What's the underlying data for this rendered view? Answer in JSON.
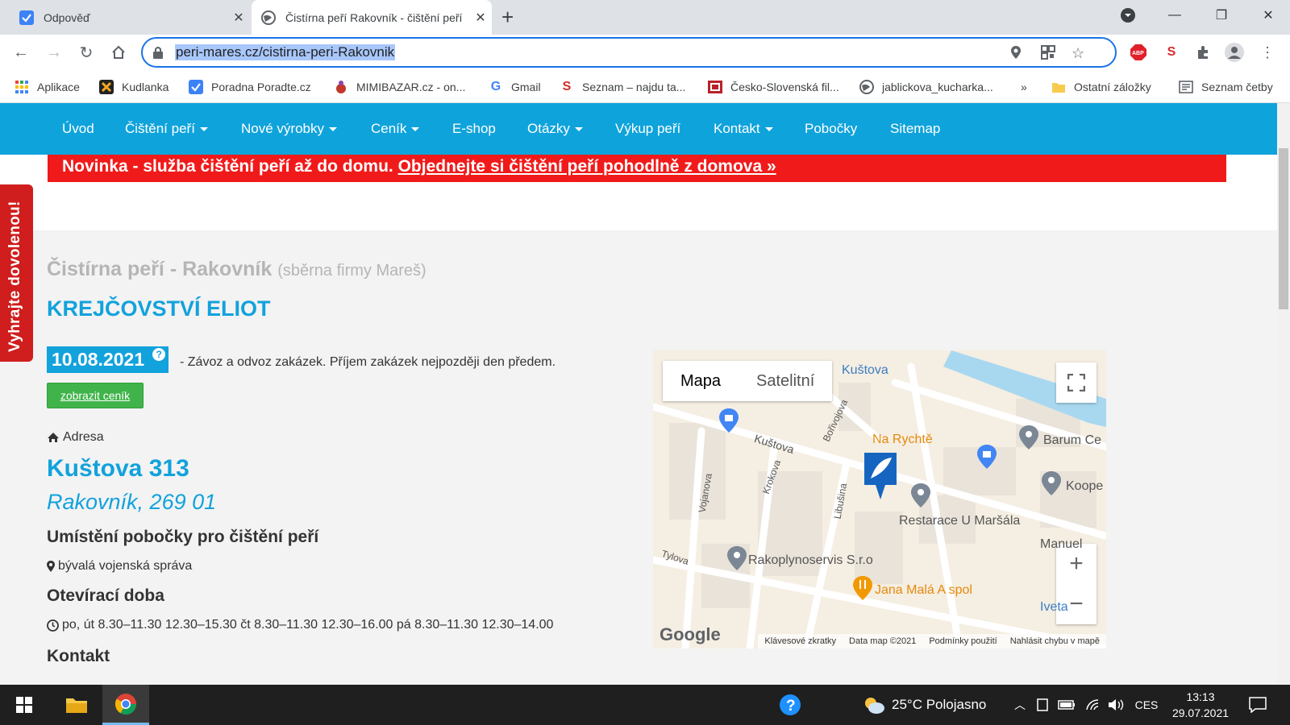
{
  "browser": {
    "tabs": [
      {
        "title": "Odpověď"
      },
      {
        "title": "Čistírna peří Rakovník - čištění peří"
      }
    ],
    "url": "peri-mares.cz/cistirna-peri-Rakovnik",
    "bookmarks": [
      {
        "label": "Aplikace",
        "icon": "apps-icon"
      },
      {
        "label": "Kudlanka",
        "icon": "kudlanka-icon"
      },
      {
        "label": "Poradna Poradte.cz",
        "icon": "checkbox-icon"
      },
      {
        "label": "MIMIBAZAR.cz - on...",
        "icon": "mimibazar-icon"
      },
      {
        "label": "Gmail",
        "icon": "google-icon"
      },
      {
        "label": "Seznam – najdu ta...",
        "icon": "seznam-icon"
      },
      {
        "label": "Česko-Slovenská fil...",
        "icon": "csfd-icon"
      },
      {
        "label": "jablickova_kucharka...",
        "icon": "globe-icon"
      }
    ],
    "bookmarks_more": "»",
    "other_bookmarks": "Ostatní záložky",
    "reading_list": "Seznam četby"
  },
  "site": {
    "menu": [
      {
        "label": "Úvod",
        "dropdown": false
      },
      {
        "label": "Čištění peří",
        "dropdown": true
      },
      {
        "label": "Nové výrobky",
        "dropdown": true
      },
      {
        "label": "Ceník",
        "dropdown": true
      },
      {
        "label": "E-shop",
        "dropdown": false
      },
      {
        "label": "Otázky",
        "dropdown": true
      },
      {
        "label": "Výkup peří",
        "dropdown": false
      },
      {
        "label": "Kontakt",
        "dropdown": true
      },
      {
        "label": "Pobočky",
        "dropdown": false
      },
      {
        "label": "Sitemap",
        "dropdown": false
      }
    ],
    "banner": {
      "text": "Novinka - služba čištění peří až do domu.",
      "link": "Objednejte si čištění peří pohodlně z domova »"
    },
    "side_tab": "Vyhrajte dovolenou!",
    "heading_sub": "Čistírna peří - Rakovník",
    "heading_sub_note": "(sběrna firmy Mareš)",
    "heading_main": "KREJČOVSTVÍ ELIOT",
    "date": "10.08.2021",
    "date_help": "?",
    "date_note": "- Závoz a odvoz zakázek. Příjem zakázek nejpozději den předem.",
    "price_button": "zobrazit ceník",
    "address_label": "Adresa",
    "street": "Kuštova 313",
    "city": "Rakovník, 269 01",
    "location_heading": "Umístění pobočky pro čištění peří",
    "location_text": "bývalá vojenská správa",
    "hours_heading": "Otevírací doba",
    "hours_text": "po, út 8.30–11.30 12.30–15.30 čt 8.30–11.30 12.30–16.00 pá 8.30–11.30 12.30–14.00",
    "contact_heading": "Kontakt"
  },
  "map": {
    "type_map": "Mapa",
    "type_satellite": "Satelitní",
    "zoom_in": "+",
    "zoom_out": "−",
    "pois": {
      "kustova_top": "Kuštova",
      "na_rychte": "Na Rychtě",
      "barum": "Barum Ce",
      "koope": "Koope",
      "restaurace": "Restarace U Maršála",
      "rakoplynoservis": "Rakoplynoservis S.r.o",
      "jana_mala": "Jana Malá A spol",
      "iveta": "Iveta",
      "manuel": "Manuel",
      "kustova": "Kuštova",
      "borivojova": "Bořivojova",
      "krokova": "Krokova",
      "vojanova": "Vojanova",
      "libusina": "Libušina",
      "tylova": "Tylova"
    },
    "google": "Google",
    "attribution": [
      "Klávesové zkratky",
      "Data map ©2021",
      "Podmínky použití",
      "Nahlásit chybu v mapě"
    ]
  },
  "taskbar": {
    "weather": "25°C Polojasno",
    "language": "CES",
    "time": "13:13",
    "date": "29.07.2021"
  },
  "colors": {
    "brand": "#12a2dc",
    "menu": "#0fa3dc",
    "banner": "#f11a1a",
    "button": "#40b44a"
  }
}
